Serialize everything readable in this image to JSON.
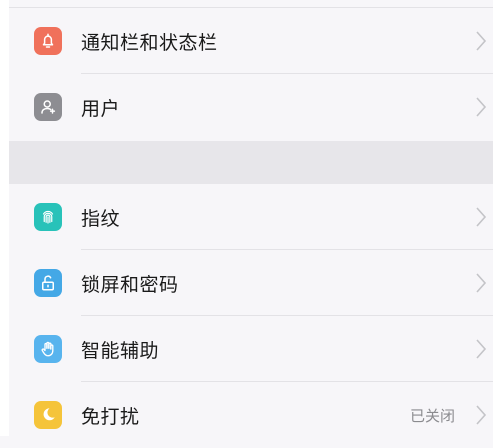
{
  "settings": {
    "items_top": [
      {
        "label": "通知栏和状态栏",
        "icon": "bell-icon",
        "color": "#f0715b"
      },
      {
        "label": "用户",
        "icon": "user-icon",
        "color": "#8d8d92"
      }
    ],
    "items_bottom": [
      {
        "label": "指纹",
        "icon": "fingerprint-icon",
        "color": "#28c2b9"
      },
      {
        "label": "锁屏和密码",
        "icon": "lock-icon",
        "color": "#44a8e6"
      },
      {
        "label": "智能辅助",
        "icon": "hand-icon",
        "color": "#58b4ee"
      },
      {
        "label": "免打扰",
        "icon": "moon-icon",
        "color": "#f5c43a",
        "value": "已关闭"
      }
    ]
  },
  "colors": {
    "background": "#f7f6f9",
    "section_gap": "#e7e6ea",
    "chevron": "#c4c4c8"
  }
}
